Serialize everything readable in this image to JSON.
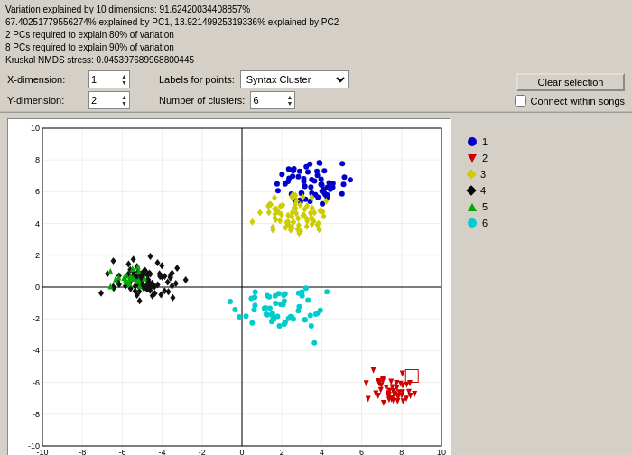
{
  "info": {
    "line1": "Variation explained by 10 dimensions: 91.62420034408857%",
    "line2": "67.40251779556274% explained by PC1, 13.92149925319336% explained by PC2",
    "line3": "2 PCs required to explain 80% of variation",
    "line4": "8 PCs required to explain 90% of variation",
    "line5": "Kruskal NMDS stress: 0.045397689968800445"
  },
  "controls": {
    "x_label": "X-dimension:",
    "y_label": "Y-dimension:",
    "x_value": "1",
    "y_value": "2",
    "labels_label": "Labels for points:",
    "labels_value": "Syntax Cluster",
    "clusters_label": "Number of clusters:",
    "clusters_value": "6",
    "clear_label": "Clear selection",
    "connect_label": "Connect within songs"
  },
  "legend": {
    "items": [
      {
        "id": 1,
        "label": "1",
        "color": "#0000cc",
        "shape": "circle"
      },
      {
        "id": 2,
        "label": "2",
        "color": "#cc0000",
        "shape": "triangle-down"
      },
      {
        "id": 3,
        "label": "3",
        "color": "#cccc00",
        "shape": "diamond"
      },
      {
        "id": 4,
        "label": "4",
        "color": "#000000",
        "shape": "diamond"
      },
      {
        "id": 5,
        "label": "5",
        "color": "#00aa00",
        "shape": "triangle-up"
      },
      {
        "id": 6,
        "label": "6",
        "color": "#00cccc",
        "shape": "circle"
      }
    ]
  },
  "chart": {
    "x_min": -10,
    "x_max": 10,
    "y_min": -10,
    "y_max": 10,
    "x_ticks": [
      -10,
      -8,
      -6,
      -4,
      -2,
      0,
      2,
      4,
      6,
      8,
      10
    ],
    "y_ticks": [
      10,
      8,
      6,
      4,
      2,
      0,
      -2,
      -4,
      -6,
      -8,
      -10
    ]
  }
}
